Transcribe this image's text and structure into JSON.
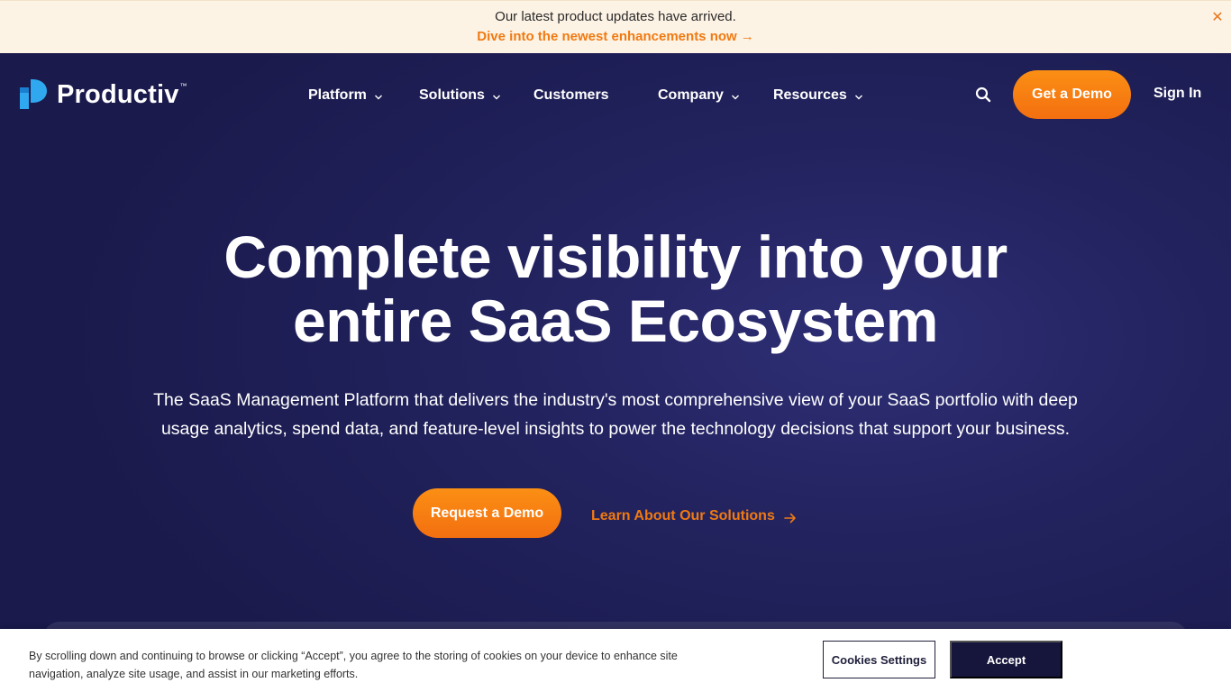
{
  "banner": {
    "message": "Our latest product updates have arrived.",
    "link_text": "Dive into the newest enhancements now",
    "link_arrow": "→",
    "close_glyph": "✕"
  },
  "header": {
    "logo_text": "Productiv",
    "logo_tm": "™",
    "logo_icon": "productiv-logo-mark",
    "nav": [
      {
        "label": "Platform",
        "has_dropdown": true
      },
      {
        "label": "Solutions",
        "has_dropdown": true
      },
      {
        "label": "Customers",
        "has_dropdown": false
      },
      {
        "label": "Company",
        "has_dropdown": true
      },
      {
        "label": "Resources",
        "has_dropdown": true
      }
    ],
    "search_icon": "search-icon",
    "cta_label": "Get a Demo",
    "sign_in_label": "Sign In"
  },
  "hero": {
    "headline_line1": "Complete visibility into your",
    "headline_line2": "entire SaaS Ecosystem",
    "subtext": "The SaaS Management Platform that delivers the industry's most comprehensive view of your SaaS portfolio with deep usage analytics, spend data, and feature-level insights to power the technology decisions that support your business.",
    "primary_cta": "Request a Demo",
    "secondary_cta": "Learn About Our Solutions"
  },
  "cookie": {
    "text": "By scrolling down and continuing to browse or clicking “Accept”, you agree to the storing of cookies on your device to enhance site navigation, analyze site usage, and assist in our marketing efforts.",
    "settings_label": "Cookies Settings",
    "accept_label": "Accept"
  },
  "colors": {
    "accent_orange": "#f47a12",
    "hero_bg": "#22225e",
    "banner_bg": "#fdf3e5",
    "dark_button": "#16163c"
  }
}
